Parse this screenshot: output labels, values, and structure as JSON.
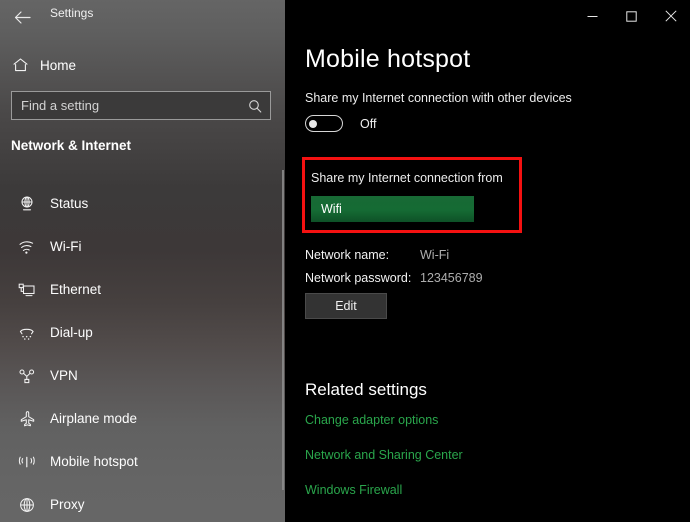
{
  "window": {
    "app_title": "Settings",
    "back_icon": "back-arrow-icon",
    "controls": {
      "minimize": "—",
      "maximize": "☐",
      "close": "✕"
    }
  },
  "sidebar": {
    "home": {
      "label": "Home",
      "icon": "home-icon"
    },
    "search": {
      "placeholder": "Find a setting",
      "value": "",
      "icon": "search-icon"
    },
    "section_title": "Network & Internet",
    "items": [
      {
        "label": "Status",
        "icon": "status-globe-icon"
      },
      {
        "label": "Wi-Fi",
        "icon": "wifi-icon"
      },
      {
        "label": "Ethernet",
        "icon": "ethernet-icon"
      },
      {
        "label": "Dial-up",
        "icon": "dialup-icon"
      },
      {
        "label": "VPN",
        "icon": "vpn-icon"
      },
      {
        "label": "Airplane mode",
        "icon": "airplane-icon"
      },
      {
        "label": "Mobile hotspot",
        "icon": "mobile-hotspot-icon"
      },
      {
        "label": "Proxy",
        "icon": "proxy-globe-icon"
      }
    ]
  },
  "main": {
    "page_title": "Mobile hotspot",
    "share_label": "Share my Internet connection with other devices",
    "toggle_state": "Off",
    "highlight": {
      "from_label": "Share my Internet connection from",
      "selected_source": "Wifi",
      "border_color": "#f41111",
      "dropdown_color": "#156b34"
    },
    "details": [
      {
        "key": "Network name:",
        "value": "Wi-Fi"
      },
      {
        "key": "Network password:",
        "value": "123456789"
      }
    ],
    "edit_button": "Edit",
    "related": {
      "title": "Related settings",
      "link_color": "#2aa64c",
      "links": [
        "Change adapter options",
        "Network and Sharing Center",
        "Windows Firewall"
      ]
    }
  }
}
